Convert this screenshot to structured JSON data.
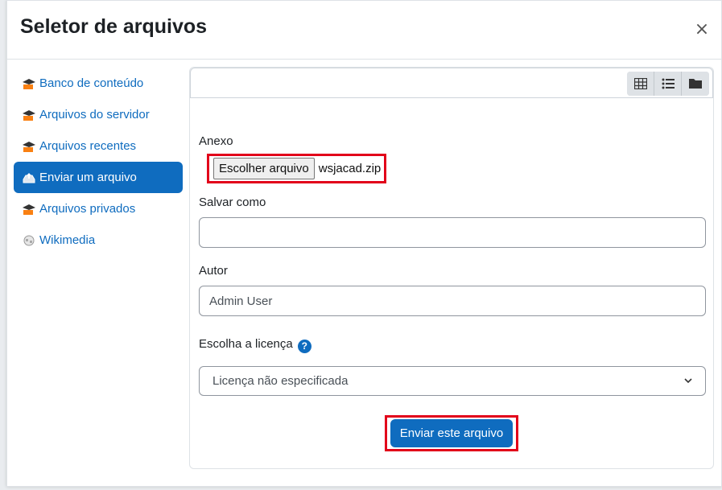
{
  "dialog": {
    "title": "Seletor de arquivos",
    "close_symbol": "×"
  },
  "sidebar": {
    "items": [
      {
        "label": "Banco de conteúdo",
        "icon": "moodle-hat-icon",
        "active": false
      },
      {
        "label": "Arquivos do servidor",
        "icon": "moodle-hat-icon",
        "active": false
      },
      {
        "label": "Arquivos recentes",
        "icon": "moodle-hat-icon",
        "active": false
      },
      {
        "label": "Enviar um arquivo",
        "icon": "upload-icon",
        "active": true
      },
      {
        "label": "Arquivos privados",
        "icon": "moodle-hat-icon",
        "active": false
      },
      {
        "label": "Wikimedia",
        "icon": "wikimedia-globe-icon",
        "active": false
      }
    ]
  },
  "toolbar": {
    "views": [
      "grid-view-icon",
      "list-view-icon",
      "folder-view-icon"
    ]
  },
  "form": {
    "attachment_label": "Anexo",
    "choose_file_label": "Escolher arquivo",
    "chosen_file": "wsjacad.zip",
    "save_as_label": "Salvar como",
    "save_as_value": "",
    "author_label": "Autor",
    "author_value": "Admin User",
    "license_label": "Escolha a licença",
    "help_symbol": "?",
    "license_selected": "Licença não especificada",
    "submit_label": "Enviar este arquivo"
  },
  "colors": {
    "primary": "#0f6cbf",
    "highlight": "#e2001a",
    "moodle_orange": "#f98012"
  }
}
